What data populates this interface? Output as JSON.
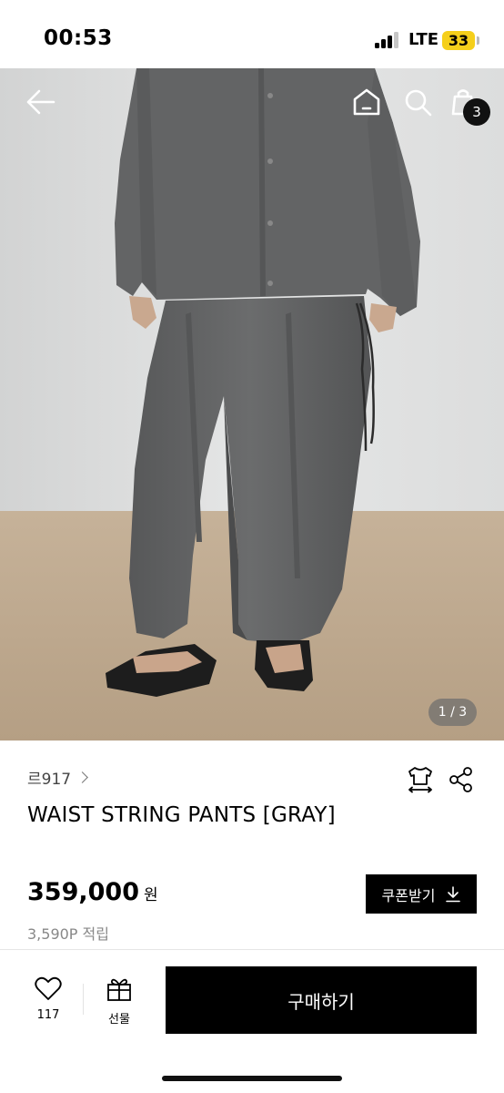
{
  "status_bar": {
    "time": "00:53",
    "network": "LTE",
    "battery": "33"
  },
  "header": {
    "cart_count": "3"
  },
  "gallery": {
    "page_indicator": "1 / 3"
  },
  "product": {
    "brand": "르917",
    "title": "WAIST STRING PANTS [GRAY]",
    "price": "359,000",
    "currency": "원",
    "points": "3,590P 적립",
    "coupon_label": "쿠폰받기"
  },
  "bottom_bar": {
    "like_count": "117",
    "gift_label": "선물",
    "buy_label": "구매하기"
  },
  "colors": {
    "accent": "#000000",
    "battery": "#f5cf1b"
  },
  "icons": [
    "back-arrow-icon",
    "home-icon",
    "search-icon",
    "shopping-bag-icon",
    "size-guide-icon",
    "share-icon",
    "download-icon",
    "heart-icon",
    "gift-icon",
    "chevron-right-icon"
  ]
}
